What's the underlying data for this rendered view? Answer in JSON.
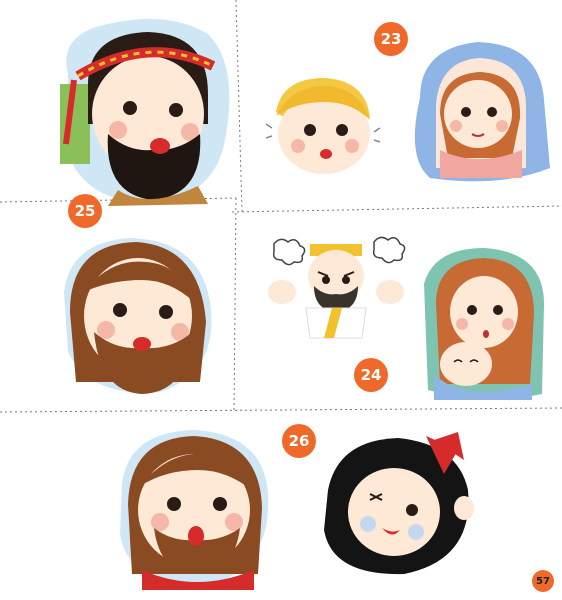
{
  "page": {
    "page_number": "57"
  },
  "badges": {
    "b23": "23",
    "b24": "24",
    "b25": "25",
    "b26": "26"
  },
  "colors": {
    "accent": "#ef6a2a",
    "skin": "#fde9d6",
    "blush": "#f5b7a7",
    "hair_brown": "#8a4a22",
    "sky": "#cfe7f5"
  },
  "icons": {
    "face": "character-face",
    "anger": "anger-puff"
  }
}
